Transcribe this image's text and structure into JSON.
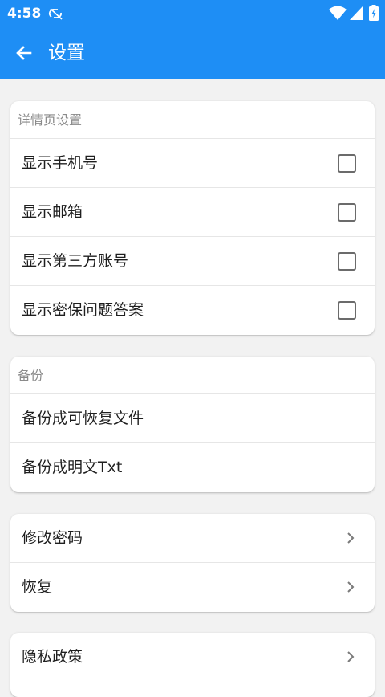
{
  "status_bar": {
    "time": "4:58",
    "icons": [
      "sync-off-icon",
      "wifi-icon",
      "signal-icon",
      "battery-icon"
    ]
  },
  "app_bar": {
    "title": "设置",
    "back_icon": "arrow-left-icon",
    "color": "#1e8ef5"
  },
  "sections": [
    {
      "header": "详情页设置",
      "items": [
        {
          "label": "显示手机号",
          "control": "checkbox",
          "checked": false
        },
        {
          "label": "显示邮箱",
          "control": "checkbox",
          "checked": false
        },
        {
          "label": "显示第三方账号",
          "control": "checkbox",
          "checked": false
        },
        {
          "label": "显示密保问题答案",
          "control": "checkbox",
          "checked": false
        }
      ]
    },
    {
      "header": "备份",
      "items": [
        {
          "label": "备份成可恢复文件"
        },
        {
          "label": "备份成明文Txt"
        }
      ]
    },
    {
      "header": "",
      "items": [
        {
          "label": "修改密码",
          "control": "chevron"
        },
        {
          "label": "恢复",
          "control": "chevron"
        }
      ]
    },
    {
      "header": "",
      "items": [
        {
          "label": "隐私政策",
          "control": "chevron"
        }
      ]
    }
  ]
}
